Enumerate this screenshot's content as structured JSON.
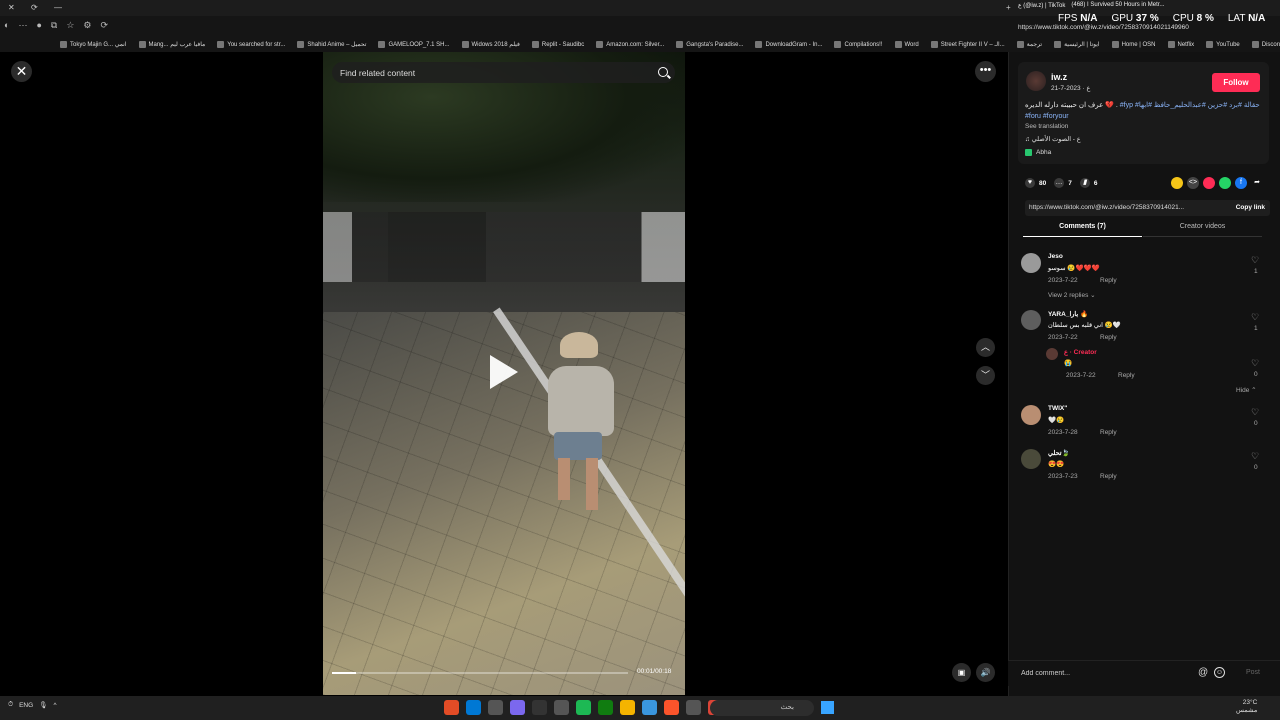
{
  "browser": {
    "tabs": [
      {
        "label": "ع (@iw.z) | TikTok"
      },
      {
        "label": "(468) I Survived 50 Hours in Metr..."
      }
    ],
    "url": "https://www.tiktok.com/@iw.z/video/7258370914021149960",
    "perf": {
      "fps_label": "FPS",
      "fps_value": "N/A",
      "gpu_label": "GPU",
      "gpu_value": "37 %",
      "cpu_label": "CPU",
      "cpu_value": "8 %",
      "lat_label": "LAT",
      "lat_value": "N/A"
    },
    "bookmarks": [
      "Tokyo Majin G... انمي",
      "Mang... مافيا عرب ليم",
      "You searched for str...",
      "Shahid Anime – تحميل",
      "GAMELOOP_7.1 SH...",
      "Widows 2018 فيلم",
      "Replit - Saudibc",
      "Amazon.com: Silver...",
      "Gangsta's Paradise...",
      "DownloadGram - In...",
      "Compilations!!",
      "Word",
      "Street Fighter II V – الـ...",
      "ترجمة",
      "ايوتا | الرئيسية",
      "Home | OSN",
      "Netflix",
      "YouTube",
      "Discord"
    ]
  },
  "video": {
    "search_placeholder": "Find related content",
    "time": "00:01/00:18",
    "progress": 0.08
  },
  "post": {
    "username": "iw.z",
    "date": "ع · 2023-7-21",
    "follow_label": "Follow",
    "caption_text": "عرف ان حبيبته دارله الديره 💔 .",
    "caption_tags": "#fyp #حقالة #برد #حزين #عبدالحليم_حافظ #ابها #foru #foryour",
    "see_translation": "See translation",
    "music": "♫ ع - الصوت الأصلي",
    "location": "Abha",
    "likes": "80",
    "comments": "7",
    "saves": "6",
    "link": "https://www.tiktok.com/@iw.z/video/7258370914021...",
    "copy_link": "Copy link"
  },
  "tabs": {
    "comments": "Comments (7)",
    "creator_videos": "Creator videos"
  },
  "comments": [
    {
      "name": "Jeso",
      "text": "سوسو 😢❤️❤️❤️",
      "date": "2023-7-22",
      "reply": "Reply",
      "likes": "1"
    },
    {
      "name": "YARA_بارا 🔥",
      "text": "اني قلبه بس سلطان 😢🤍",
      "date": "2023-7-22",
      "reply": "Reply",
      "likes": "1"
    },
    {
      "name": "ع · Creator",
      "text": "😭",
      "date": "2023-7-22",
      "reply": "Reply",
      "likes": "0"
    },
    {
      "name": "TWIX\"",
      "text": "🤍😢",
      "date": "2023-7-28",
      "reply": "Reply",
      "likes": "0"
    },
    {
      "name": "تحلي🍃",
      "text": "😍😍",
      "date": "2023-7-23",
      "reply": "Reply",
      "likes": "0"
    }
  ],
  "view_replies": "View 2 replies ⌄",
  "hide_label": "Hide ⌃",
  "add_comment_placeholder": "Add comment...",
  "post_label": "Post",
  "taskbar": {
    "lang": "ENG",
    "search": "بحث",
    "weather": "23°C",
    "weather_sub": "مشمس"
  },
  "icons": {
    "close": "close-icon",
    "more": "more-icon",
    "up": "chevron-up-icon",
    "down": "chevron-down-icon",
    "play": "play-icon",
    "search": "search-icon"
  },
  "colors": {
    "accent": "#fe2c55",
    "tag_blue": "#8ab4f8"
  }
}
